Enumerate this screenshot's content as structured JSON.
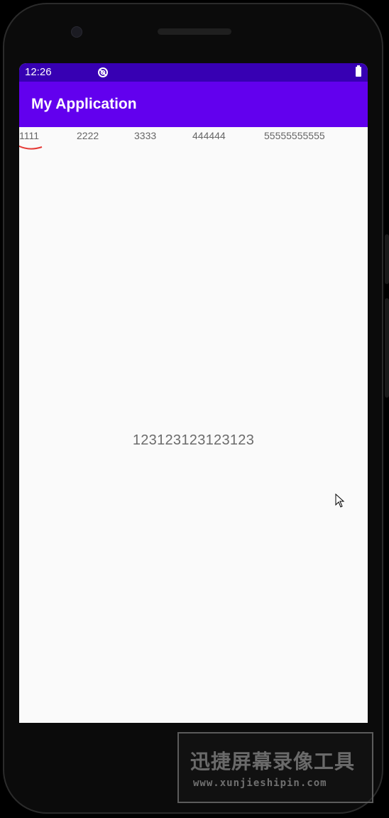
{
  "status_bar": {
    "time": "12:26",
    "sync_icon": "sync-disabled-icon",
    "battery_icon": "battery-full-icon"
  },
  "app_bar": {
    "title": "My Application",
    "color": "#6200ee"
  },
  "tabs": [
    {
      "label": "1111",
      "selected": true
    },
    {
      "label": "2222",
      "selected": false
    },
    {
      "label": "3333",
      "selected": false
    },
    {
      "label": "444444",
      "selected": false
    },
    {
      "label": "55555555555",
      "selected": false
    }
  ],
  "tab_indicator_color": "#e53935",
  "content": {
    "center_text": "123123123123123"
  },
  "watermark": {
    "title": "迅捷屏幕录像工具",
    "url": "www.xunjieshipin.com"
  },
  "colors": {
    "status_bar": "#3700b3",
    "primary": "#6200ee",
    "background": "#fafafa"
  }
}
